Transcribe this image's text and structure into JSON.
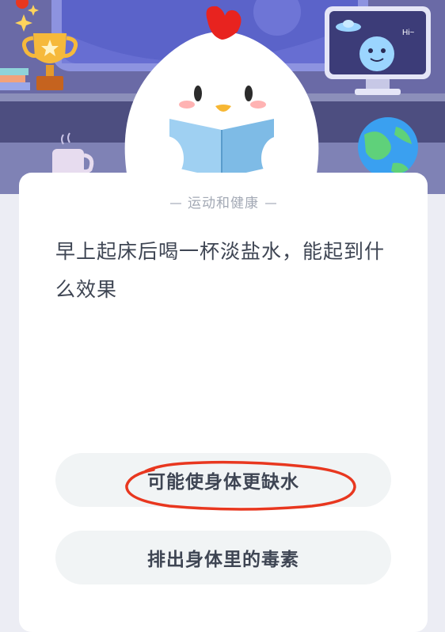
{
  "quiz": {
    "category": "运动和健康",
    "question": "早上起床后喝一杯淡盐水，能起到什么效果",
    "options": [
      {
        "label": "可能使身体更缺水",
        "selected": true
      },
      {
        "label": "排出身体里的毒素",
        "selected": false
      }
    ]
  },
  "scene": {
    "speech_text": "Hi~",
    "mascot": "chicken-mascot-reading-book",
    "annotation_color": "#e8371f"
  }
}
